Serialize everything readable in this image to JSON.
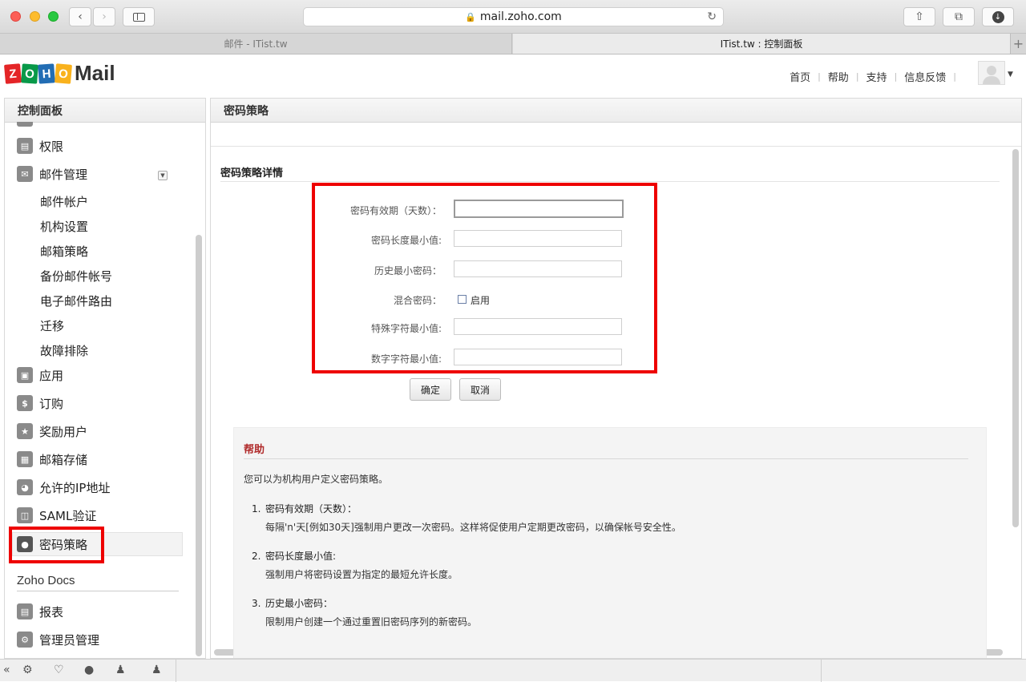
{
  "browser": {
    "url": "mail.zoho.com",
    "tabs": [
      "邮件 - ITist.tw",
      "ITist.tw : 控制面板"
    ]
  },
  "header": {
    "logo_letters": [
      "Z",
      "O",
      "H",
      "O"
    ],
    "logo_colors": [
      "#e42527",
      "#089949",
      "#226db4",
      "#f9b21d"
    ],
    "logo_text": "Mail",
    "nav": [
      "首页",
      "帮助",
      "支持",
      "信息反馈"
    ]
  },
  "sidebar": {
    "title": "控制面板",
    "items_top": [
      {
        "label": "权限",
        "icon": "document-icon"
      },
      {
        "label": "邮件管理",
        "icon": "mail-icon"
      }
    ],
    "mail_sub_items": [
      "邮件帐户",
      "机构设置",
      "邮箱策略",
      "备份邮件帐号",
      "电子邮件路由",
      "迁移",
      "故障排除"
    ],
    "items_bottom": [
      {
        "label": "应用",
        "icon": "app-icon"
      },
      {
        "label": "订购",
        "icon": "dollar-icon"
      },
      {
        "label": "奖励用户",
        "icon": "reward-icon"
      },
      {
        "label": "邮箱存储",
        "icon": "storage-icon"
      },
      {
        "label": "允许的IP地址",
        "icon": "globe-icon"
      },
      {
        "label": "SAML验证",
        "icon": "monitor-icon"
      },
      {
        "label": "密码策略",
        "icon": "lock-icon"
      }
    ],
    "docs_section": "Zoho Docs",
    "docs_items": [
      {
        "label": "报表",
        "icon": "report-icon"
      },
      {
        "label": "管理员管理",
        "icon": "admin-icon"
      }
    ]
  },
  "main": {
    "title": "密码策略",
    "section_title": "密码策略详情",
    "form": {
      "expiry_label": "密码有效期（天数）：",
      "expiry_value": "",
      "min_length_label": "密码长度最小值:",
      "min_length_value": "",
      "history_label": "历史最小密码：",
      "history_value": "",
      "mixed_label": "混合密码：",
      "mixed_checkbox_label": "启用",
      "special_label": "特殊字符最小值:",
      "special_value": "",
      "digits_label": "数字字符最小值:",
      "digits_value": ""
    },
    "ok_button": "确定",
    "cancel_button": "取消",
    "help": {
      "title": "帮助",
      "intro": "您可以为机构用户定义密码策略。",
      "items": [
        {
          "num": "1.",
          "title": "密码有效期（天数）：",
          "desc": "每隔'n'天[例如30天]强制用户更改一次密码。这样将促使用户定期更改密码，以确保帐号安全性。"
        },
        {
          "num": "2.",
          "title": "密码长度最小值:",
          "desc": "强制用户将密码设置为指定的最短允许长度。"
        },
        {
          "num": "3.",
          "title": "历史最小密码：",
          "desc": "限制用户创建一个通过重置旧密码序列的新密码。"
        }
      ]
    }
  }
}
